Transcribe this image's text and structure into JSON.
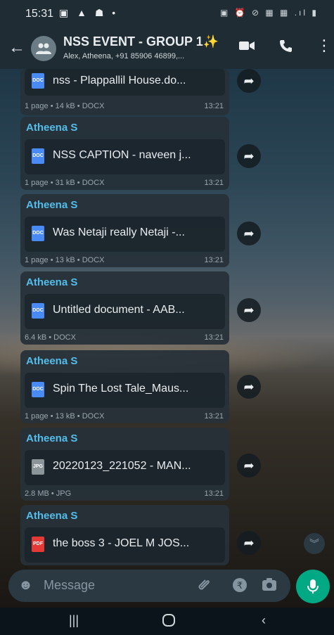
{
  "status_bar": {
    "time": "15:31",
    "left_icons": "▣ ▲ ☗ •",
    "right_icons": "▣ ⏰ ⊘ ▦ ▦ .ıl ▮"
  },
  "header": {
    "title": "NSS EVENT - GROUP 1✨",
    "subtitle": "Alex, Atheena, +91 85906 46899,..."
  },
  "messages": [
    {
      "sender": "",
      "file_type": "DOC",
      "filename": "nss - Plappallil House.do...",
      "meta": "1 page • 14 kB • DOCX",
      "time": "13:21"
    },
    {
      "sender": "Atheena S",
      "file_type": "DOC",
      "filename": "NSS CAPTION - naveen j...",
      "meta": "1 page • 31 kB • DOCX",
      "time": "13:21"
    },
    {
      "sender": "Atheena S",
      "file_type": "DOC",
      "filename": "Was Netaji really Netaji -...",
      "meta": "1 page • 13 kB • DOCX",
      "time": "13:21"
    },
    {
      "sender": "Atheena S",
      "file_type": "DOC",
      "filename": "Untitled document - AAB...",
      "meta": "6.4 kB • DOCX",
      "time": "13:21"
    },
    {
      "sender": "Atheena S",
      "file_type": "DOC",
      "filename": "Spin The Lost Tale_Maus...",
      "meta": "1 page • 13 kB • DOCX",
      "time": "13:21"
    },
    {
      "sender": "Atheena S",
      "file_type": "JPG",
      "filename": "20220123_221052 - MAN...",
      "meta": "2.8 MB • JPG",
      "time": "13:21"
    },
    {
      "sender": "Atheena S",
      "file_type": "PDF",
      "filename": "the boss 3 - JOEL M JOS...",
      "meta": "",
      "time": ""
    }
  ],
  "composer": {
    "placeholder": "Message"
  },
  "icons": {
    "back": "back-arrow-icon",
    "video": "video-call-icon",
    "call": "phone-icon",
    "menu": "more-options-icon",
    "forward": "forward-icon",
    "emoji": "emoji-icon",
    "attach": "attach-icon",
    "payment": "rupee-payment-icon",
    "camera": "camera-icon",
    "mic": "microphone-icon"
  },
  "colors": {
    "header": "#1f2c34",
    "bubble": "#263138",
    "sender": "#53bdeb",
    "mic": "#00a884",
    "doc_icon": "#4a8af4",
    "jpg_icon": "#8a9499",
    "pdf_icon": "#e53935"
  }
}
